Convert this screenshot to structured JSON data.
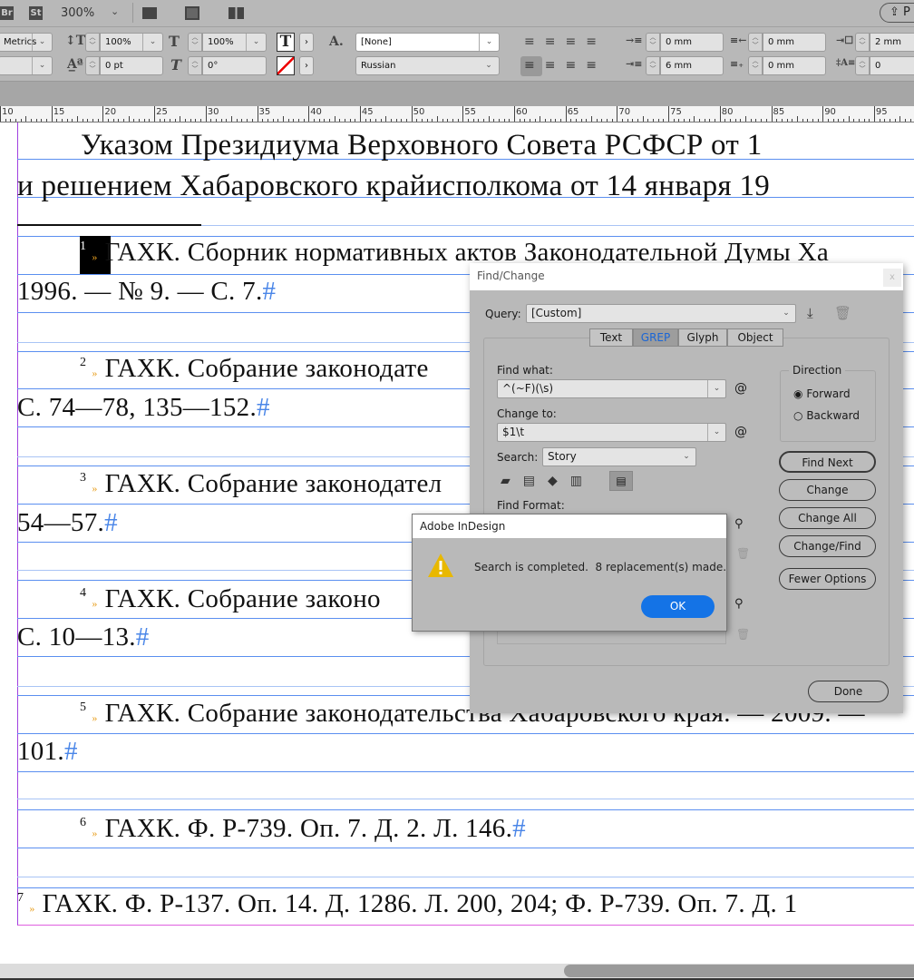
{
  "topbar": {
    "br_label": "Br",
    "st_label": "St",
    "zoom": "300%",
    "publish_label": "P"
  },
  "control": {
    "kerning": "Metrics",
    "vscale": "100%",
    "hscale": "100%",
    "baseline": "0 pt",
    "skew": "0°",
    "char_style": "[None]",
    "language": "Russian",
    "left_indent": "0 mm",
    "right_indent": "0 mm",
    "first_indent": "6 mm",
    "last_indent": "0 mm",
    "space_before": "2 mm",
    "drop_cap": "0"
  },
  "ruler": {
    "labels": [
      "10",
      "15",
      "20",
      "25",
      "30",
      "35",
      "40",
      "45",
      "50",
      "55",
      "60",
      "65",
      "70",
      "75",
      "80",
      "85",
      "90",
      "95"
    ]
  },
  "document": {
    "lines": [
      {
        "text": "Указом Президиума Верховного Совета РСФСР от 1",
        "end": ""
      },
      {
        "text": "и решением Хабаровского крайисполкома от 14 января 19",
        "end": ""
      },
      {
        "num": "1",
        "text": "ГАХК. Сборник нормативных актов Законодательной Думы Ха",
        "end": ""
      },
      {
        "text": "1996. — № 9. — С. 7.",
        "end": "#"
      },
      {
        "num": "2",
        "text": "ГАХК. Собрание законодате",
        "end": ""
      },
      {
        "text": "С. 74—78, 135—152.",
        "end": "#"
      },
      {
        "num": "3",
        "text": "ГАХК. Собрание законодател",
        "end": ""
      },
      {
        "text": "54—57.",
        "end": "#"
      },
      {
        "num": "4",
        "text": "ГАХК. Собрание законо",
        "end": ""
      },
      {
        "text": "С. 10—13.",
        "end": "#"
      },
      {
        "num": "5",
        "text": "ГАХК. Собрание законодательства Хабаровского края. — 2009. —",
        "end": ""
      },
      {
        "text": "101.",
        "end": "#"
      },
      {
        "num": "6",
        "text": "ГАХК. Ф. Р-739. Оп. 7. Д. 2. Л. 146.",
        "end": "#"
      },
      {
        "num": "7",
        "text": "ГАХК. Ф. Р-137. Оп. 14. Д. 1286. Л. 200, 204; Ф. Р-739. Оп. 7. Д. 1",
        "end": ""
      }
    ]
  },
  "find_change": {
    "title": "Find/Change",
    "close": "x",
    "query_label": "Query:",
    "query_value": "[Custom]",
    "tabs": [
      "Text",
      "GREP",
      "Glyph",
      "Object"
    ],
    "find_what_label": "Find what:",
    "find_what_value": "^(~F)(\\s)",
    "change_to_label": "Change to:",
    "change_to_value": "$1\\t",
    "search_label": "Search:",
    "search_value": "Story",
    "find_format_label": "Find Format:",
    "direction_label": "Direction",
    "forward": "Forward",
    "backward": "Backward",
    "buttons": {
      "find_next": "Find Next",
      "change": "Change",
      "change_all": "Change All",
      "change_find": "Change/Find",
      "fewer_options": "Fewer Options",
      "done": "Done"
    }
  },
  "alert": {
    "title": "Adobe InDesign",
    "message": "Search is completed.  8 replacement(s) made.",
    "ok": "OK"
  },
  "colors": {
    "accent": "#1473e6",
    "guide": "#5b8ff0",
    "warning": "#e8b800"
  }
}
